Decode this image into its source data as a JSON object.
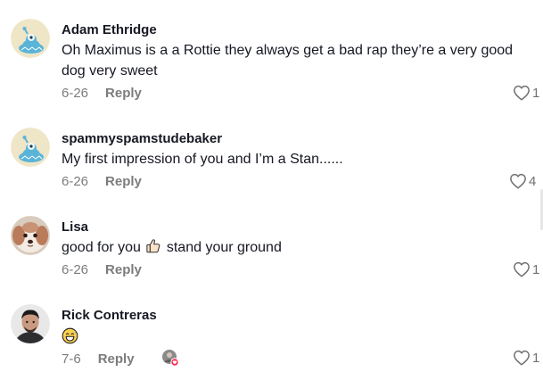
{
  "comments": [
    {
      "name": "Adam Ethridge",
      "text": "Oh Maximus is a a Rottie they always get a bad rap they’re a very good dog very sweet",
      "date": "6-26",
      "reply": "Reply",
      "likes": "1",
      "avatar": "blue-cartoon-avatar"
    },
    {
      "name": "spammyspamstudebaker",
      "text": "My first impression of you and I’m a Stan......",
      "date": "6-26",
      "reply": "Reply",
      "likes": "4",
      "avatar": "blue-cartoon-avatar"
    },
    {
      "name": "Lisa",
      "text_before": "good for you",
      "text_emoji": "thumbs-up",
      "text_after": "stand your ground",
      "date": "6-26",
      "reply": "Reply",
      "likes": "1",
      "avatar": "dog-photo-avatar"
    },
    {
      "name": "Rick Contreras",
      "text_emoji": "grinning-sweat-face",
      "date": "7-6",
      "reply": "Reply",
      "likes": "1",
      "avatar": "man-photo-avatar",
      "creator_liked": "creator-liked-badge"
    }
  ],
  "colors": {
    "name": "#161823",
    "meta": "#7c7c7c",
    "avatar_bg": "#efe6c8",
    "avatar_blue": "#5ab4d8"
  }
}
